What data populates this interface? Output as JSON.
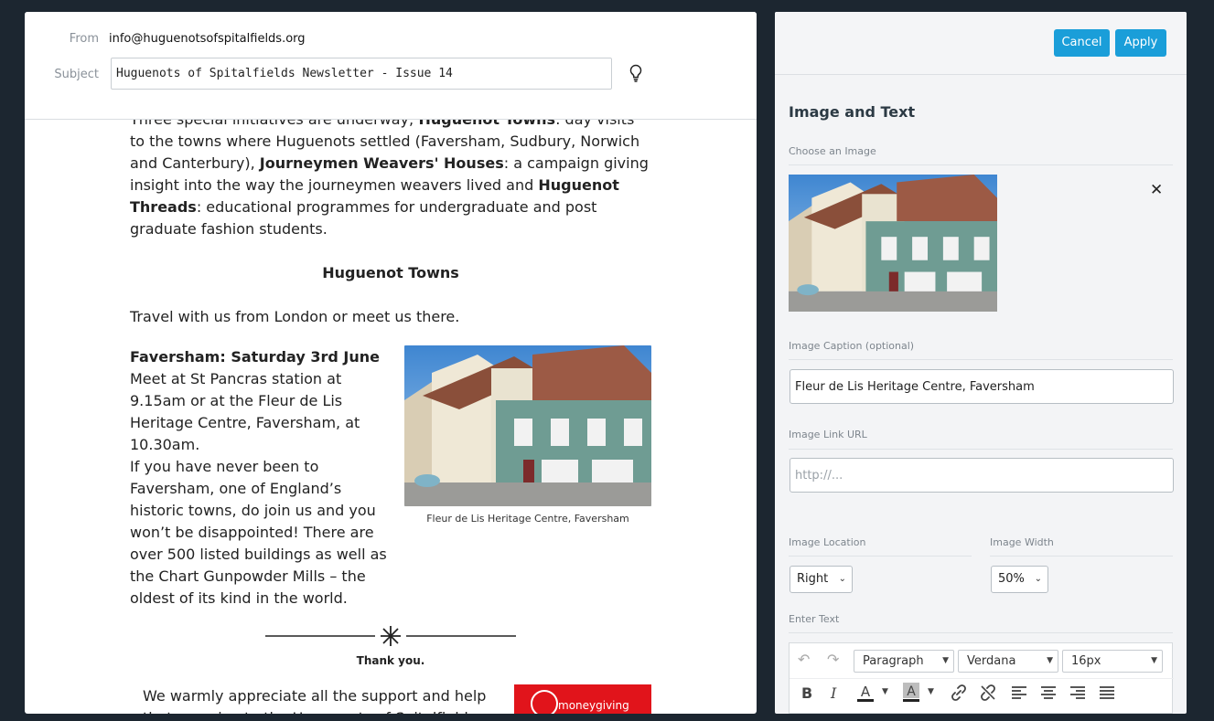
{
  "email": {
    "from_label": "From",
    "from_value": "info@huguenotsofspitalfields.org",
    "subject_label": "Subject",
    "subject_value": "Huguenots of Spitalfields Newsletter - Issue 14",
    "body": {
      "initiatives_intro": "Three special initiatives are underway; ",
      "initiative_1": "Huguenot Towns",
      "initiative_1_text": ": day visits to the towns where Huguenots settled (Faversham, Sudbury, Norwich and Canterbury), ",
      "initiative_2": "Journeymen Weavers' Houses",
      "initiative_2_text": ": a campaign giving insight into the way the journeymen weavers lived and ",
      "initiative_3": "Huguenot Threads",
      "initiative_3_text": ": educational programmes for undergraduate and post graduate fashion students.",
      "section_heading": "Huguenot Towns",
      "travel_text": "Travel with us from London or meet us there.",
      "event_heading": "Faversham: Saturday 3rd June",
      "event_meet": "Meet at St Pancras station at 9.15am or at the Fleur de Lis Heritage Centre, Faversham, at 10.30am.",
      "event_desc": "If you have never been to Faversham, one of England’s historic towns, do join us and you won’t be disappointed! There are over 500 listed buildings as well as the Chart Gunpowder Mills – the oldest of its kind in the world.",
      "image_caption": "Fleur de Lis Heritage Centre, Faversham",
      "thank_you": "Thank you.",
      "appreciate_text": "We warmly appreciate all the support and help that you give to the Huguenots of Spitalfields",
      "badge_text": "moneygiving"
    }
  },
  "editor": {
    "cancel_label": "Cancel",
    "apply_label": "Apply",
    "title": "Image and Text",
    "choose_image_label": "Choose an Image",
    "caption_label": "Image Caption (optional)",
    "caption_value": "Fleur de Lis Heritage Centre, Faversham",
    "link_label": "Image Link URL",
    "link_placeholder": "http://...",
    "location_label": "Image Location",
    "location_value": "Right",
    "width_label": "Image Width",
    "width_value": "50%",
    "text_label": "Enter Text",
    "toolbar": {
      "paragraph": "Paragraph",
      "font": "Verdana",
      "size": "16px",
      "bold": "B",
      "italic": "I"
    }
  },
  "colors": {
    "accent": "#1a9ed9",
    "page_bg": "#1c2630",
    "badge": "#e1141b"
  }
}
